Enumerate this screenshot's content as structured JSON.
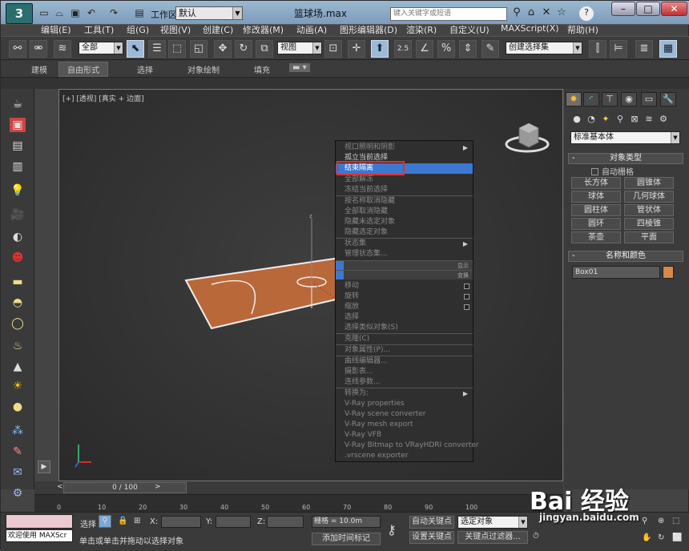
{
  "app": {
    "title": "篮球场.max",
    "workspace_label": "工作区:",
    "workspace_value": "默认",
    "search_placeholder": "键入关键字或短语",
    "help_label": "?",
    "logo": "3"
  },
  "menu": [
    "编辑(E)",
    "工具(T)",
    "组(G)",
    "视图(V)",
    "创建(C)",
    "修改器(M)",
    "动画(A)",
    "图形编辑器(D)",
    "渲染(R)",
    "自定义(U)",
    "MAXScript(X)",
    "帮助(H)"
  ],
  "toolbar": {
    "filter": "全部",
    "refcoord": "视图",
    "selset": "创建选择集",
    "snap_label": "2.5",
    "percent_label": "%"
  },
  "ribbon_tabs": [
    "建模",
    "自由形式",
    "选择",
    "对象绘制",
    "填充"
  ],
  "ribbon_active": 1,
  "viewport": {
    "label": "[+] [透视] [真实 + 边面]",
    "axis_z": "z"
  },
  "context_menu": {
    "items": [
      {
        "label": "视口照明和阴影",
        "dim": true,
        "arrow": true
      },
      {
        "label": "孤立当前选择",
        "dim": false
      },
      {
        "label": "结束隔离",
        "dim": false,
        "highlight": true
      },
      {
        "label": "全部解冻",
        "dim": true
      },
      {
        "label": "冻结当前选择",
        "dim": true
      },
      {
        "label": "按名称取消隐藏",
        "dim": true
      },
      {
        "label": "全部取消隐藏",
        "dim": true
      },
      {
        "label": "隐藏未选定对象",
        "dim": true
      },
      {
        "label": "隐藏选定对象",
        "dim": true
      },
      {
        "label": "状态集",
        "dim": true,
        "arrow": true
      },
      {
        "label": "管理状态集...",
        "dim": true
      },
      {
        "label": "移动",
        "dim": true,
        "box": true
      },
      {
        "label": "旋转",
        "dim": true,
        "box": true
      },
      {
        "label": "缩放",
        "dim": true,
        "box": true
      },
      {
        "label": "选择",
        "dim": true
      },
      {
        "label": "选择类似对象(S)",
        "dim": true
      },
      {
        "label": "克隆(C)",
        "dim": true
      },
      {
        "label": "对象属性(P)...",
        "dim": true
      },
      {
        "label": "曲线编辑器...",
        "dim": true
      },
      {
        "label": "摄影表...",
        "dim": true
      },
      {
        "label": "连线参数...",
        "dim": true
      },
      {
        "label": "转换为:",
        "dim": true,
        "arrow": true
      },
      {
        "label": "V-Ray properties",
        "dim": true
      },
      {
        "label": "V-Ray scene converter",
        "dim": true
      },
      {
        "label": "V-Ray mesh export",
        "dim": true
      },
      {
        "label": "V-Ray VFB",
        "dim": true
      },
      {
        "label": "V-Ray Bitmap to VRayHDRI converter",
        "dim": true
      },
      {
        "label": ".vrscene exporter",
        "dim": true
      }
    ],
    "header_display": "显示",
    "header_transform": "变换"
  },
  "command_panel": {
    "dropdown": "标准基本体",
    "object_type_title": "对象类型",
    "autogrid": "自动栅格",
    "buttons": [
      "长方体",
      "圆锥体",
      "球体",
      "几何球体",
      "圆柱体",
      "管状体",
      "圆环",
      "四棱锥",
      "茶壶",
      "平面"
    ],
    "name_color_title": "名称和颜色",
    "name_value": "Box01",
    "object_color": "#d8884a"
  },
  "timeline": {
    "slider": "0 / 100",
    "ticks": [
      "0",
      "10",
      "20",
      "30",
      "40",
      "50",
      "60",
      "70",
      "80",
      "90",
      "100"
    ]
  },
  "status": {
    "welcome": "欢迎使用 MAXScr",
    "select_label": "选择",
    "x_label": "X:",
    "y_label": "Y:",
    "z_label": "Z:",
    "grid": "栅格 = 10.0m",
    "autokey": "自动关键点",
    "setkey": "设置关键点",
    "selected": "选定对象",
    "keyfilter": "关键点过滤器...",
    "prompt": "单击或单击并拖动以选择对象",
    "add_tag": "添加时间标记"
  },
  "watermark": {
    "brand": "Bai 经验",
    "url": "jingyan.baidu.com"
  }
}
